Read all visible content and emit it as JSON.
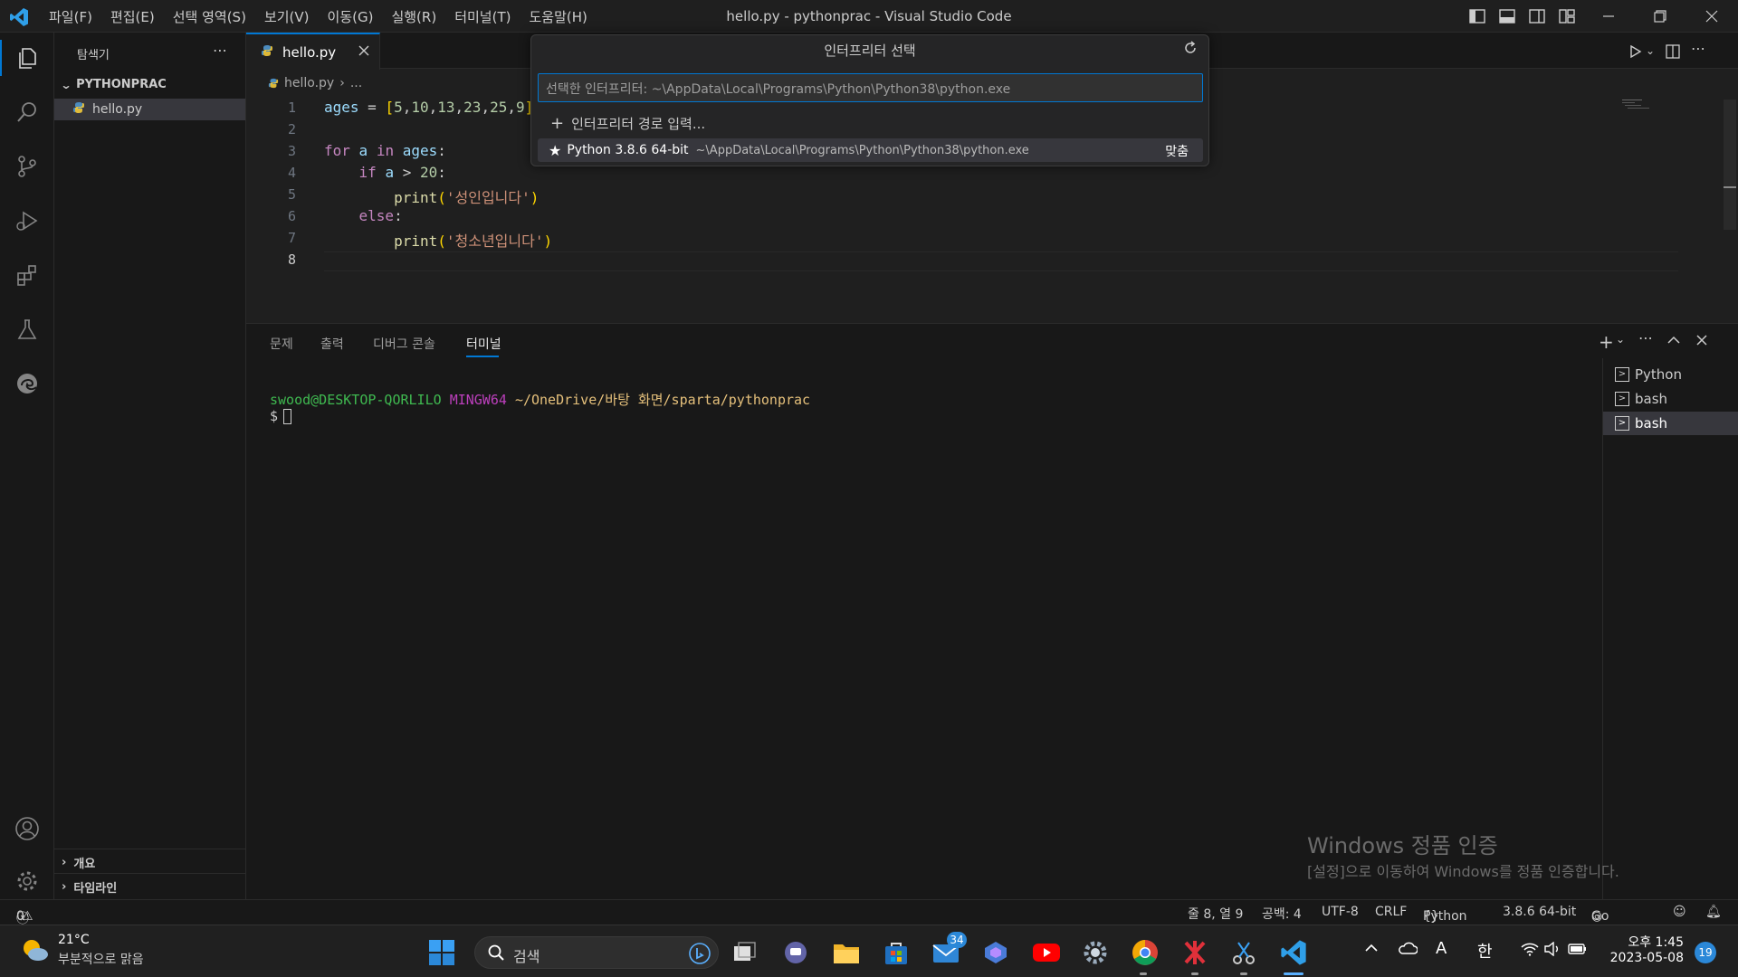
{
  "titlebar": {
    "menus": [
      "파일(F)",
      "편집(E)",
      "선택 영역(S)",
      "보기(V)",
      "이동(G)",
      "실행(R)",
      "터미널(T)",
      "도움말(H)"
    ],
    "title": "hello.py - pythonprac - Visual Studio Code"
  },
  "sidebar": {
    "title": "탐색기",
    "folder": "PYTHONPRAC",
    "file": "hello.py",
    "outline": "개요",
    "timeline": "타임라인"
  },
  "editor": {
    "tab": "hello.py",
    "breadcrumb_file": "hello.py",
    "breadcrumb_more": "...",
    "line_numbers": [
      "1",
      "2",
      "3",
      "4",
      "5",
      "6",
      "7",
      "8"
    ],
    "lines": [
      "ages = [5,10,13,23,25,9]",
      "",
      "for a in ages:",
      "    if a > 20:",
      "        print('성인입니다')",
      "    else:",
      "        print('청소년입니다')",
      ""
    ]
  },
  "quickpick": {
    "title": "인터프리터 선택",
    "input_placeholder": "선택한 인터프리터: ~\\AppData\\Local\\Programs\\Python\\Python38\\python.exe",
    "enter_path": "인터프리터 경로 입력...",
    "item_name": "Python 3.8.6 64-bit",
    "item_path": "~\\AppData\\Local\\Programs\\Python\\Python38\\python.exe",
    "item_badge": "맞춤"
  },
  "panel": {
    "tabs": [
      "문제",
      "출력",
      "디버그 콘솔",
      "터미널"
    ],
    "prompt_user": "swood@DESKTOP-QORLILO",
    "prompt_env": "MINGW64",
    "prompt_path": "~/OneDrive/바탕 화면/sparta/pythonprac",
    "prompt_symbol": "$",
    "terminals": [
      "Python",
      "bash",
      "bash"
    ]
  },
  "watermark": {
    "title": "Windows 정품 인증",
    "subtitle": "[설정]으로 이동하여 Windows를 정품 인증합니다."
  },
  "statusbar": {
    "errors": "0",
    "warnings": "0",
    "position": "줄 8, 열 9",
    "spaces": "공백: 4",
    "encoding": "UTF-8",
    "eol": "CRLF",
    "language": "Python",
    "interpreter": "3.8.6 64-bit",
    "golive": "Go Live"
  },
  "taskbar": {
    "temp": "21°C",
    "weather": "부분적으로 맑음",
    "search": "검색",
    "mail_badge": "34",
    "ime_a": "A",
    "ime_han": "한",
    "time": "오후 1:45",
    "date": "2023-05-08",
    "notif": "19"
  },
  "colors": {
    "accent": "#0078d4",
    "bg": "#1f1f1f",
    "sidebar": "#181818"
  }
}
